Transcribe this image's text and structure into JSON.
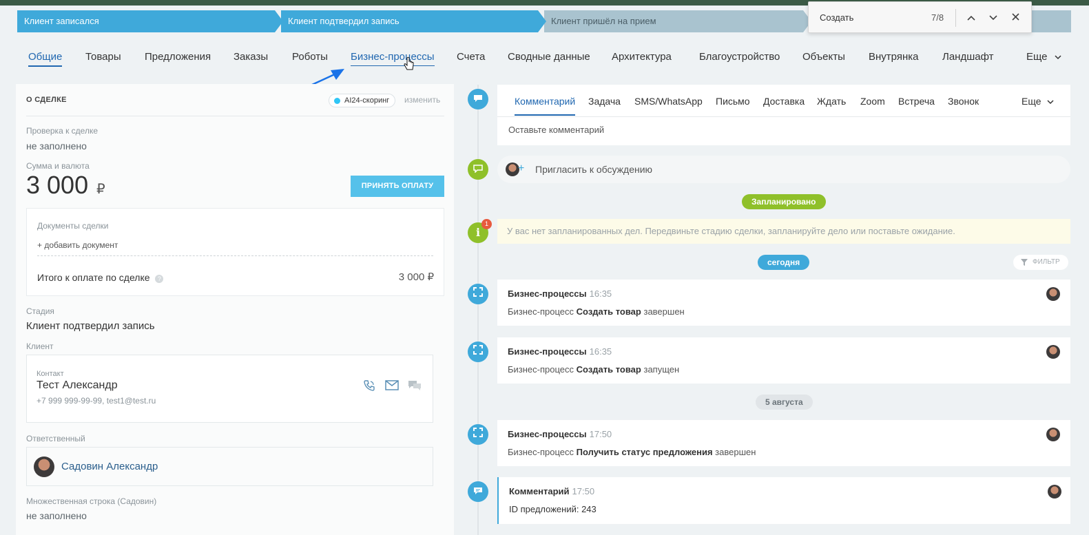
{
  "stages": [
    {
      "label": "Клиент записался"
    },
    {
      "label": "Клиент подтвердил запись"
    },
    {
      "label": "Клиент пришёл на прием"
    }
  ],
  "find": {
    "query": "Создать",
    "count": "7/8",
    "up": "⌃",
    "down": "⌄",
    "close": "✕"
  },
  "tabs": [
    "Общие",
    "Товары",
    "Предложения",
    "Заказы",
    "Роботы",
    "Бизнес-процессы",
    "Счета",
    "Сводные данные",
    "Архитектура",
    "Благоустройство",
    "Объекты",
    "Внутрянка",
    "Ландшафт",
    "Еще"
  ],
  "deal": {
    "section_title": "О СДЕЛКЕ",
    "ai_badge": "AI24-скоринг",
    "edit": "изменить",
    "check_label": "Проверка к сделке",
    "check_value": "не заполнено",
    "sum_label": "Сумма и валюта",
    "amount": "3 000",
    "currency": "₽",
    "pay_button": "ПРИНЯТЬ ОПЛАТУ",
    "docs_label": "Документы сделки",
    "add_doc": "+ добавить документ",
    "total_label": "Итого к оплате по сделке",
    "total_value": "3 000 ₽",
    "stage_label": "Стадия",
    "stage_value": "Клиент подтвердил запись",
    "client_label": "Клиент",
    "contact_label": "Контакт",
    "contact_name": "Тест Александр",
    "contact_info": "+7 999 999-99-99, test1@test.ru",
    "resp_label": "Ответственный",
    "resp_name": "Садовин Александр",
    "multi_label": "Множественная строка (Садовин)",
    "multi_value": "не заполнено"
  },
  "editor": {
    "tabs": [
      "Комментарий",
      "Задача",
      "SMS/WhatsApp",
      "Письмо",
      "Доставка",
      "Ждать",
      "Zoom",
      "Встреча",
      "Звонок",
      "Еще"
    ],
    "placeholder": "Оставьте комментарий"
  },
  "timeline": {
    "invite": "Пригласить к обсуждению",
    "planned": "Запланировано",
    "notice": "У вас нет запланированных дел. Передвиньте стадию сделки, запланируйте дело или поставьте ожидание.",
    "notice_badge": "1",
    "today": "сегодня",
    "filter": "ФИЛЬТР",
    "date_aug": "5 августа",
    "items": [
      {
        "title": "Бизнес-процессы",
        "time": "16:35",
        "pre": "Бизнес-процесс",
        "bold": "Создать товар",
        "post": "завершен"
      },
      {
        "title": "Бизнес-процессы",
        "time": "16:35",
        "pre": "Бизнес-процесс",
        "bold": "Создать товар",
        "post": "запущен"
      },
      {
        "title": "Бизнес-процессы",
        "time": "17:50",
        "pre": "Бизнес-процесс",
        "bold": "Получить статус предложения",
        "post": "завершен"
      },
      {
        "title": "Комментарий",
        "time": "17:50",
        "pre": "ID предложений: 243",
        "bold": "",
        "post": ""
      }
    ]
  }
}
